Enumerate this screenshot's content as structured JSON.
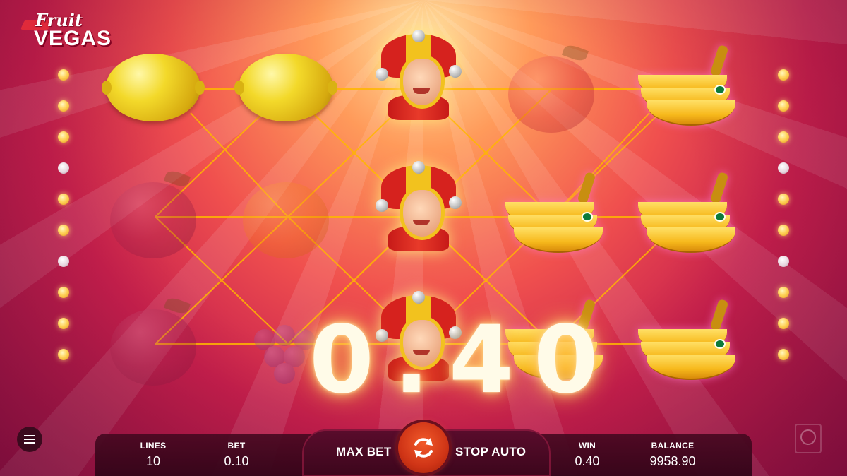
{
  "logo": {
    "line1": "Fruit",
    "line2": "VEGAS"
  },
  "win_display": "0.40",
  "stats": {
    "lines": {
      "label": "LINES",
      "value": "10"
    },
    "bet": {
      "label": "BET",
      "value": "0.10"
    },
    "win": {
      "label": "WIN",
      "value": "0.40"
    },
    "balance": {
      "label": "BALANCE",
      "value": "9958.90"
    }
  },
  "controls": {
    "max_bet": "MAX BET",
    "stop_auto": "STOP AUTO"
  },
  "icons": {
    "menu": "hamburger-menu-icon",
    "spin": "refresh-arrows-icon",
    "provider": "provider-logo-icon"
  },
  "reels": [
    [
      "lemon",
      "plum",
      "plum"
    ],
    [
      "lemon",
      "orange",
      "grapes"
    ],
    [
      "jester",
      "jester",
      "jester"
    ],
    [
      "apple",
      "banana",
      "banana"
    ],
    [
      "banana",
      "banana",
      "banana"
    ]
  ],
  "side_lights": {
    "left": [
      true,
      true,
      true,
      false,
      true,
      true,
      false,
      true,
      true,
      true
    ],
    "right": [
      true,
      true,
      true,
      false,
      true,
      true,
      false,
      true,
      true,
      true
    ]
  },
  "colors": {
    "payline": "#ffb700",
    "accent_spin": "#cf3416",
    "bar": "#460820"
  }
}
